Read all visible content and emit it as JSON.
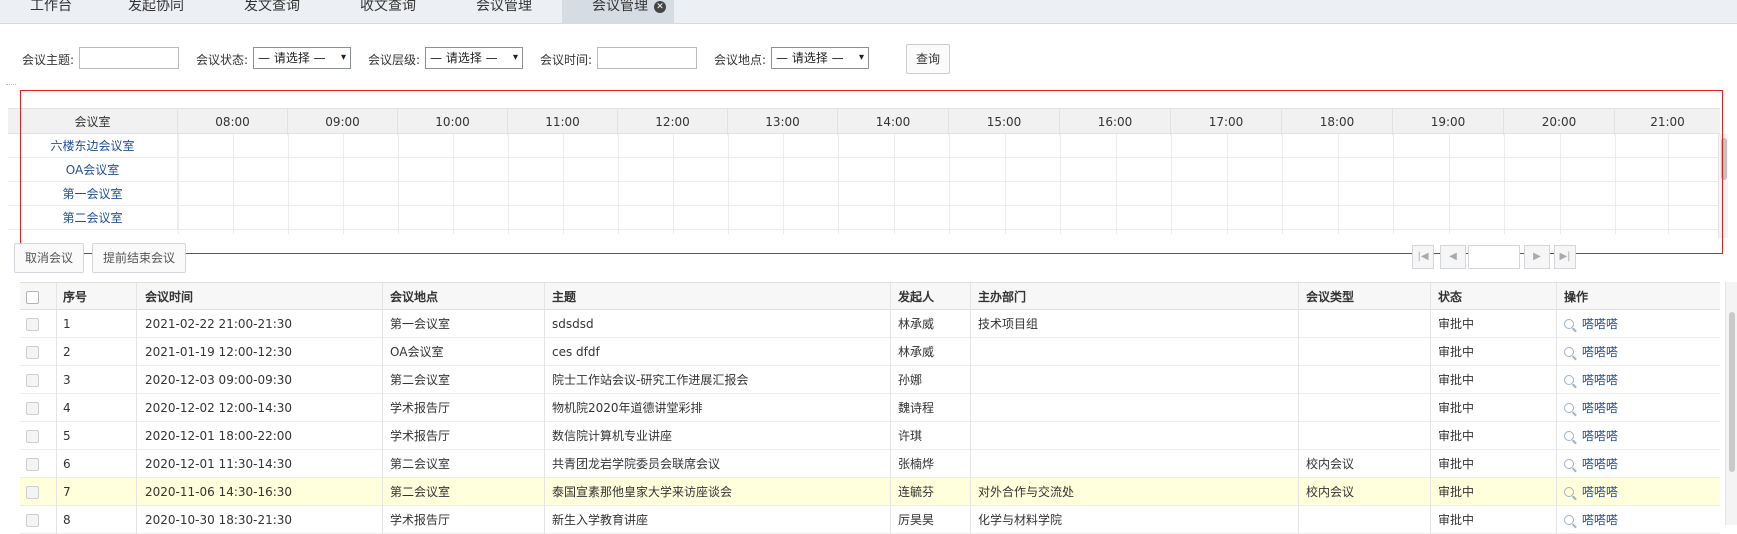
{
  "tabs": [
    {
      "label": "工作台",
      "active": false
    },
    {
      "label": "发起协同",
      "active": false
    },
    {
      "label": "发文查询",
      "active": false
    },
    {
      "label": "收文查询",
      "active": false
    },
    {
      "label": "会议管理",
      "active": false
    },
    {
      "label": "会议管理",
      "active": true,
      "close": "⊗"
    }
  ],
  "search": {
    "topic_label": "会议主题:",
    "status_label": "会议状态:",
    "status_value": "— 请选择 —",
    "level_label": "会议层级:",
    "level_value": "— 请选择 —",
    "time_label": "会议时间:",
    "place_label": "会议地点:",
    "place_value": "— 请选择 —",
    "query_button": "查询"
  },
  "schedule": {
    "room_header": "会议室",
    "hours": [
      "08:00",
      "09:00",
      "10:00",
      "11:00",
      "12:00",
      "13:00",
      "14:00",
      "15:00",
      "16:00",
      "17:00",
      "18:00",
      "19:00",
      "20:00",
      "21:00"
    ],
    "rooms": [
      "六楼东边会议室",
      "OA会议室",
      "第一会议室",
      "第二会议室"
    ]
  },
  "actions": {
    "cancel_meeting": "取消会议",
    "end_early": "提前结束会议"
  },
  "pager": {
    "first": "|◀",
    "prev": "◀",
    "page": "",
    "next": "▶",
    "last": "▶|"
  },
  "table": {
    "headers": [
      "序号",
      "会议时间",
      "会议地点",
      "主题",
      "发起人",
      "主办部门",
      "会议类型",
      "状态",
      "操作"
    ],
    "rows": [
      {
        "no": "1",
        "time": "2021-02-22 21:00-21:30",
        "place": "第一会议室",
        "topic": "sdsdsd",
        "initiator": "林承威",
        "dept": "技术项目组",
        "type": "",
        "status": "审批中",
        "op": "嗒嗒嗒"
      },
      {
        "no": "2",
        "time": "2021-01-19 12:00-12:30",
        "place": "OA会议室",
        "topic": "ces dfdf",
        "initiator": "林承威",
        "dept": "",
        "type": "",
        "status": "审批中",
        "op": "嗒嗒嗒"
      },
      {
        "no": "3",
        "time": "2020-12-03 09:00-09:30",
        "place": "第二会议室",
        "topic": "院士工作站会议-研究工作进展汇报会",
        "initiator": "孙娜",
        "dept": "",
        "type": "",
        "status": "审批中",
        "op": "嗒嗒嗒"
      },
      {
        "no": "4",
        "time": "2020-12-02 12:00-14:30",
        "place": "学术报告厅",
        "topic": "物机院2020年道德讲堂彩排",
        "initiator": "魏诗程",
        "dept": "",
        "type": "",
        "status": "审批中",
        "op": "嗒嗒嗒"
      },
      {
        "no": "5",
        "time": "2020-12-01 18:00-22:00",
        "place": "学术报告厅",
        "topic": "数信院计算机专业讲座",
        "initiator": "许琪",
        "dept": "",
        "type": "",
        "status": "审批中",
        "op": "嗒嗒嗒"
      },
      {
        "no": "6",
        "time": "2020-12-01 11:30-14:30",
        "place": "第二会议室",
        "topic": "共青团龙岩学院委员会联席会议",
        "initiator": "张楠烨",
        "dept": "",
        "type": "校内会议",
        "status": "审批中",
        "op": "嗒嗒嗒"
      },
      {
        "no": "7",
        "time": "2020-11-06 14:30-16:30",
        "place": "第二会议室",
        "topic": "泰国宣素那他皇家大学来访座谈会",
        "initiator": "连毓芬",
        "dept": "对外合作与交流处",
        "type": "校内会议",
        "status": "审批中",
        "op": "嗒嗒嗒"
      },
      {
        "no": "8",
        "time": "2020-10-30 18:30-21:30",
        "place": "学术报告厅",
        "topic": "新生入学教育讲座",
        "initiator": "厉昊昊",
        "dept": "化学与材料学院",
        "type": "",
        "status": "审批中",
        "op": "嗒嗒嗒"
      }
    ]
  }
}
